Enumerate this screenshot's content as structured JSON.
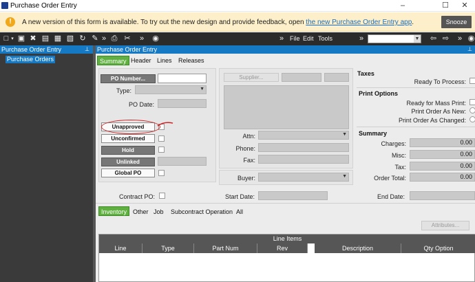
{
  "window": {
    "title": "Purchase Order Entry",
    "minimize_icon": "minimize-icon",
    "maximize_icon": "maximize-icon",
    "close_icon": "close-icon"
  },
  "banner": {
    "message": "A new version of this form is available. To try out the new design and provide feedback, open",
    "link": "the new Purchase Order Entry app",
    "suffix": ".",
    "snooze": "Snooze"
  },
  "toolbar": {
    "menus": [
      "File",
      "Edit",
      "Tools"
    ]
  },
  "tree": {
    "header": "Purchase Order Entry",
    "selected": "Purchase Orders"
  },
  "main": {
    "header": "Purchase Order Entry"
  },
  "tabs": [
    "Summary",
    "Header",
    "Lines",
    "Releases"
  ],
  "po": {
    "po_number_button": "PO Number...",
    "type_label": "Type:",
    "po_date_label": "PO Date:",
    "unapproved": "Unapproved",
    "unconfirmed": "Unconfirmed",
    "hold": "Hold",
    "unlinked": "Unlinked",
    "global_po": "Global PO"
  },
  "supplier": {
    "supplier_button": "Supplier...",
    "attn_label": "Attn:",
    "phone_label": "Phone:",
    "fax_label": "Fax:",
    "buyer_label": "Buyer:"
  },
  "taxes": {
    "title": "Taxes",
    "ready_to_process": "Ready To Process:"
  },
  "print_options": {
    "title": "Print Options",
    "ready_for_mass_print": "Ready for Mass Print:",
    "print_order_as_new": "Print Order As New:",
    "print_order_as_changed": "Print Order As Changed:"
  },
  "summary": {
    "title": "Summary",
    "charges_label": "Charges:",
    "charges": "0.00",
    "misc_label": "Misc:",
    "misc": "0.00",
    "tax_label": "Tax:",
    "tax": "0.00",
    "order_total_label": "Order Total:",
    "order_total": "0.00"
  },
  "dates": {
    "contract_po": "Contract PO:",
    "start_date": "Start Date:",
    "end_date": "End Date:"
  },
  "subtabs": [
    "Inventory",
    "Other",
    "Job",
    "Subcontract Operation",
    "All"
  ],
  "attributes_button": "Attributes...",
  "line_items": {
    "title": "Line Items",
    "columns": [
      "Line",
      "Type",
      "Part Num",
      "Rev",
      "Description",
      "Qty Option"
    ]
  },
  "colors": {
    "accent": "#1679c4",
    "active_tab": "#5fb040",
    "banner": "#fcefc9",
    "annotation": "#d02020"
  }
}
